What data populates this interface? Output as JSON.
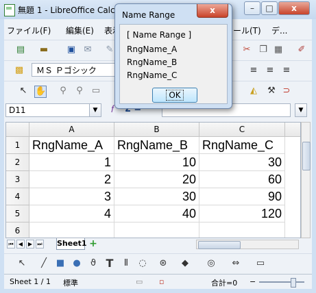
{
  "window": {
    "title": "無題 1 - LibreOffice Calc",
    "minimize": "–",
    "maximize": "□",
    "close": "x"
  },
  "menu": [
    "ファイル(F)",
    "編集(E)",
    "表示",
    "ール(T)",
    "デ..."
  ],
  "toolbar": {
    "font_name": "ＭＳ Ｐゴシック"
  },
  "formula_bar": {
    "name_box": "D11",
    "function_label": "Σ ="
  },
  "grid": {
    "columns": [
      "A",
      "B",
      "C"
    ],
    "rows": [
      "1",
      "2",
      "3",
      "4",
      "5",
      "6"
    ],
    "cells": [
      [
        "RngName_A",
        "RngName_B",
        "RngName_C"
      ],
      [
        "1",
        "10",
        "30"
      ],
      [
        "2",
        "20",
        "60"
      ],
      [
        "3",
        "30",
        "90"
      ],
      [
        "4",
        "40",
        "120"
      ],
      [
        "",
        "",
        ""
      ]
    ]
  },
  "sheet_tabs": {
    "active": "Sheet1",
    "add": "+"
  },
  "status": {
    "sheet": "Sheet 1 / 1",
    "style": "標準",
    "sum": "合計=0"
  },
  "dialog": {
    "title": "Name Range",
    "close": "x",
    "lines": [
      "[ Name Range ]",
      "RngName_A",
      "RngName_B",
      "RngName_C"
    ],
    "ok": "OK"
  }
}
